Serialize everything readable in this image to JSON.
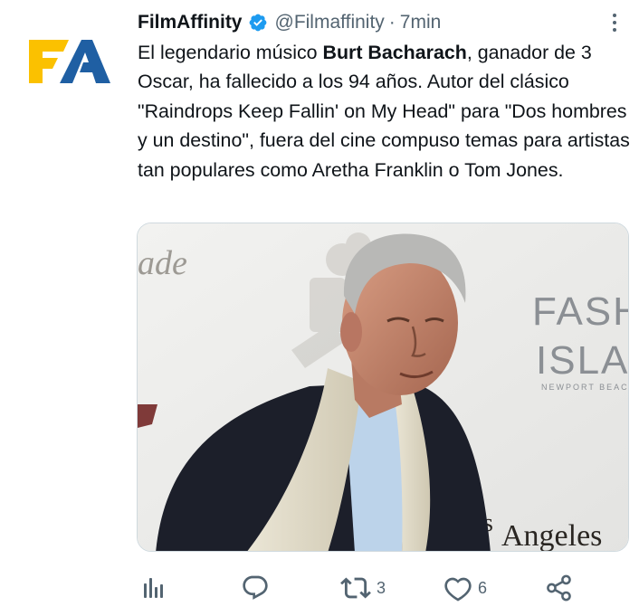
{
  "tweet": {
    "author_name": "FilmAffinity",
    "handle": "@Filmaffinity",
    "separator": "·",
    "time": "7min",
    "text_part1": "El legendario músico ",
    "text_bold": "Burt Bacharach",
    "text_part2": ", ganador de 3 Oscar, ha fallecido a los 94 años. Autor del clásico \"Raindrops Keep Fallin' on My Head\" para \"Dos hombres y un destino\", fuera del cine compuso temas para artistas tan populares como Aretha Franklin o Tom Jones.",
    "avatar_text": "FA",
    "media": {
      "backdrop_texts": [
        "ade",
        "FASH",
        "ISLA",
        "NEWPORT BEACH, CA",
        "Angeles",
        "os"
      ]
    }
  },
  "actions": {
    "retweets": "3",
    "likes": "6"
  },
  "colors": {
    "accent": "#1d9bf0",
    "logo_yellow": "#fbc100",
    "logo_blue": "#1f5fa3",
    "muted": "#536471"
  },
  "icons": [
    "verified-badge-icon",
    "more-options-icon",
    "views-icon",
    "reply-icon",
    "retweet-icon",
    "like-icon",
    "share-icon"
  ]
}
